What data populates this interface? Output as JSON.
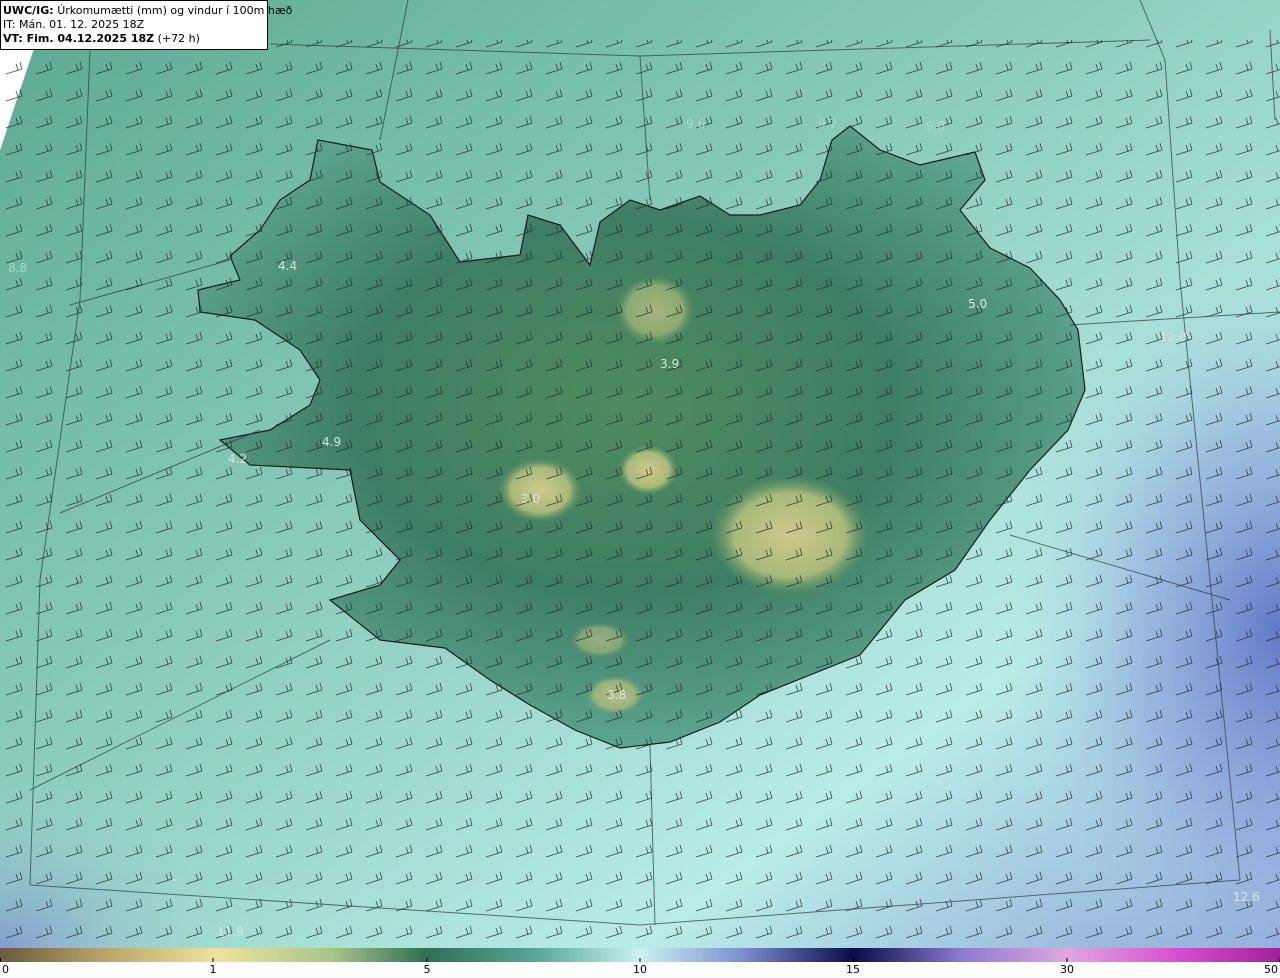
{
  "header": {
    "model_label": "UWC/IG:",
    "title": "Úrkomumætti (mm) og vindur í 100m hæð",
    "it_label": "IT:",
    "it_value": "Mán. 01. 12. 2025 18Z",
    "vt_label": "VT: Fim. 04.12.2025 18Z",
    "vt_lead": "(+72 h)"
  },
  "map": {
    "field": "precipitable water (mm)",
    "value_labels": [
      {
        "text": "4.4",
        "color": "#d8e8d8"
      },
      {
        "text": "4.9",
        "color": "#d8e8d8"
      },
      {
        "text": "4.2",
        "color": "#d8e8d8"
      },
      {
        "text": "3.0",
        "color": "#d8e8d8"
      },
      {
        "text": "3.9",
        "color": "#d8e8d8"
      },
      {
        "text": "3.8",
        "color": "#d8e8d8"
      },
      {
        "text": "5.0",
        "color": "#d8e8d8"
      },
      {
        "text": "12.0",
        "color": "#d8e8d8"
      },
      {
        "text": "12.6",
        "color": "#d8e8d8"
      },
      {
        "text": "11.9",
        "color": "#d8e8d8"
      },
      {
        "text": "9.6",
        "color": "#a9d9cc"
      },
      {
        "text": "9.7",
        "color": "#a9d9cc"
      },
      {
        "text": "9.8",
        "color": "#a9d9cc"
      },
      {
        "text": "8.8",
        "color": "#a9d9cc"
      }
    ]
  },
  "colorbar": {
    "ticks": [
      "0",
      "1",
      "5",
      "10",
      "15",
      "30",
      "50"
    ],
    "colors": [
      "#6b5a3e",
      "#b7a36a",
      "#efe39a",
      "#a8c48a",
      "#3f8a64",
      "#2f6f55",
      "#5aa89a",
      "#9fe0dc",
      "#c9f2f0",
      "#7b8fd0",
      "#2c2f9a",
      "#0b0b4a",
      "#8a7bd0",
      "#e0a6e0",
      "#d84fd0",
      "#a0209a"
    ]
  }
}
